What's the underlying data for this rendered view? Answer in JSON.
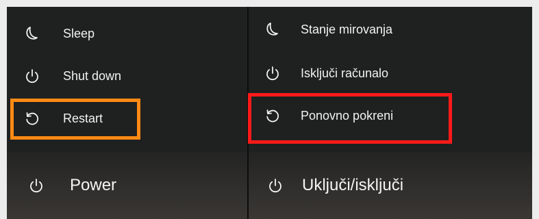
{
  "panels": {
    "english": {
      "sleep_label": "Sleep",
      "shutdown_label": "Shut down",
      "restart_label": "Restart",
      "power_label": "Power"
    },
    "croatian": {
      "sleep_label": "Stanje mirovanja",
      "shutdown_label": "Isključi računalo",
      "restart_label": "Ponovno pokreni",
      "power_label": "Uključi/isključi"
    }
  },
  "highlights": {
    "english_color": "#ff8a14",
    "croatian_color": "#ff1a1a"
  },
  "icons": {
    "sleep": "moon-icon",
    "shutdown": "power-icon",
    "restart": "restart-icon",
    "power": "power-icon"
  }
}
